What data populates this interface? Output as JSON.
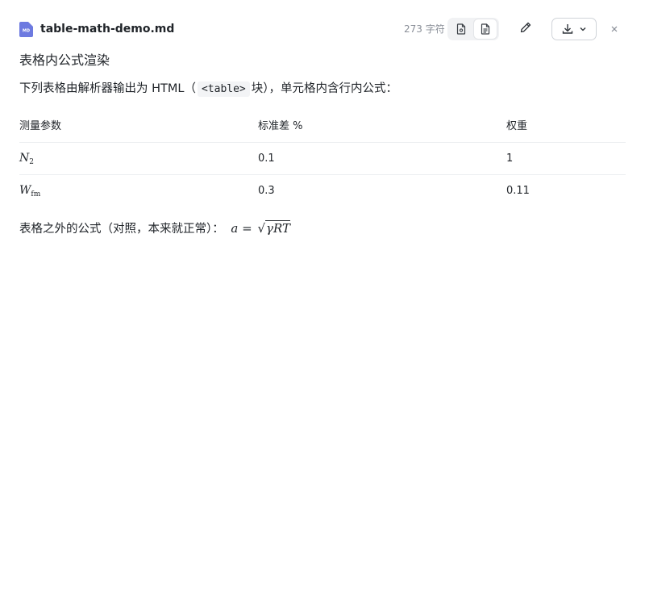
{
  "header": {
    "file_name": "table-math-demo.md",
    "file_badge": "MD",
    "char_count": "273 字符",
    "icons": {
      "file": "markdown-file-icon",
      "source_view": "source-file-icon",
      "preview_view": "document-preview-icon",
      "edit": "pencil-icon",
      "download": "download-icon",
      "dropdown": "chevron-down-icon",
      "close": "close-icon"
    },
    "accent_color": "#6d7ae0"
  },
  "doc": {
    "title": "表格内公式渲染",
    "intro_before": "下列表格由解析器输出为 HTML（",
    "intro_code": "<table>",
    "intro_after": "块），单元格内含行内公式：",
    "table": {
      "headers": [
        "测量参数",
        "标准差 %",
        "权重"
      ],
      "rows": [
        {
          "param_base": "N",
          "param_sub": "2",
          "std": "0.1",
          "weight": "1"
        },
        {
          "param_base": "W",
          "param_sub": "fm",
          "std": "0.3",
          "weight": "0.11"
        }
      ]
    },
    "outside_text": "表格之外的公式（对照，本来就正常）：",
    "outside_formula": {
      "lhs": "a",
      "eq": "=",
      "radicand": "γRT"
    }
  }
}
